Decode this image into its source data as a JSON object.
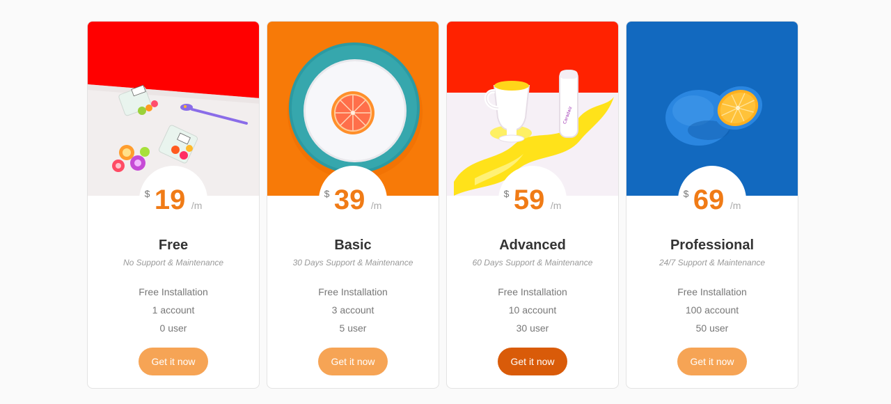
{
  "plans": [
    {
      "currency": "$",
      "price": "19",
      "period": "/m",
      "name": "Free",
      "support": "No Support & Maintenance",
      "features": [
        "Free Installation",
        "1 account",
        "0 user"
      ],
      "button": "Get it now",
      "hero_color": "#ff0000"
    },
    {
      "currency": "$",
      "price": "39",
      "period": "/m",
      "name": "Basic",
      "support": "30 Days Support & Maintenance",
      "features": [
        "Free Installation",
        "3 account",
        "5 user"
      ],
      "button": "Get it now",
      "hero_color": "#f77a08"
    },
    {
      "currency": "$",
      "price": "59",
      "period": "/m",
      "name": "Advanced",
      "support": "60 Days Support & Maintenance",
      "features": [
        "Free Installation",
        "10 account",
        "30 user"
      ],
      "button": "Get it now",
      "hero_color": "#ff2200"
    },
    {
      "currency": "$",
      "price": "69",
      "period": "/m",
      "name": "Professional",
      "support": "24/7 Support & Maintenance",
      "features": [
        "Free Installation",
        "100 account",
        "50 user"
      ],
      "button": "Get it now",
      "hero_color": "#1269bf"
    }
  ],
  "accent_color": "#f07b16",
  "button_color": "#f6a455",
  "active_button_color": "#d95b09"
}
